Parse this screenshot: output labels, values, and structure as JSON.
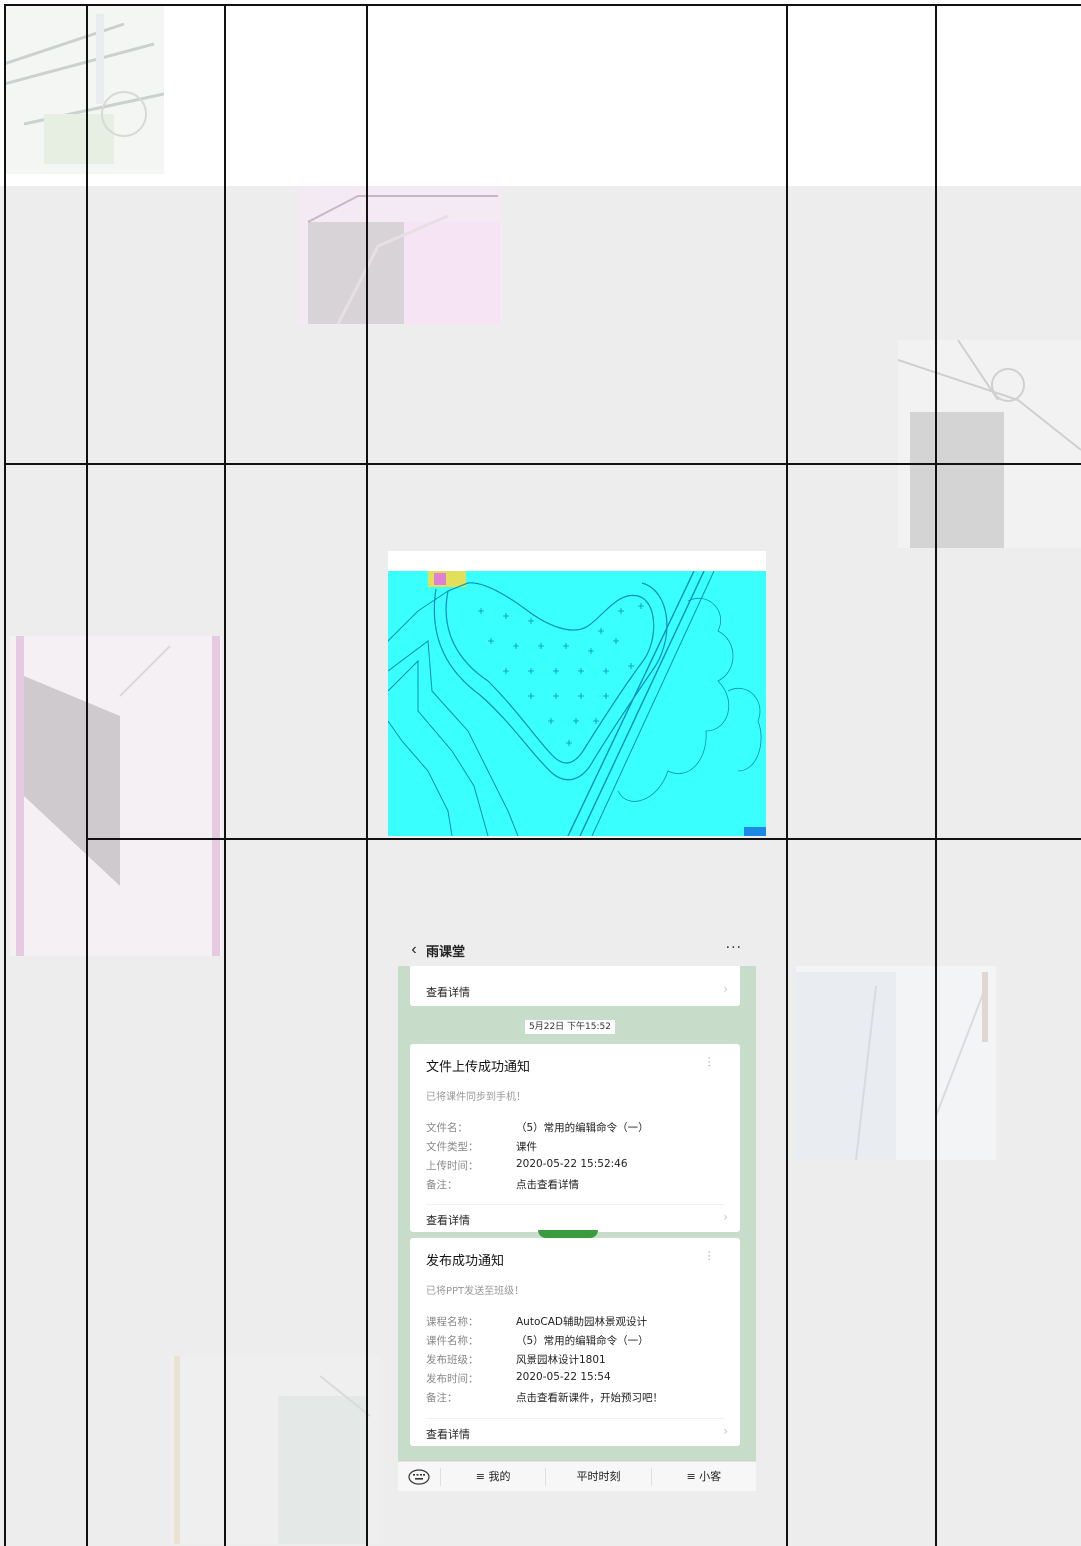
{
  "cad_image": {
    "colors": {
      "canvas": "#39ffff",
      "lines": "#0a8fb8",
      "corner": "#1e88e5"
    }
  },
  "chat": {
    "header": {
      "title": "雨课堂",
      "back_icon": "chevron-left-icon",
      "more_icon": "more-horizontal-icon",
      "more_text": "···"
    },
    "prev_card": {
      "view_detail": "查看详情"
    },
    "date_pill": "5月22日 下午15:52",
    "upload_card": {
      "title": "文件上传成功通知",
      "subtitle": "已将课件同步到手机！",
      "fields": [
        {
          "key": "文件名：",
          "value": "（5）常用的编辑命令（一）"
        },
        {
          "key": "文件类型：",
          "value": "课件"
        },
        {
          "key": "上传时间：",
          "value": "2020-05-22 15:52:46"
        },
        {
          "key": "备注：",
          "value": "点击查看详情"
        }
      ],
      "view_detail": "查看详情"
    },
    "publish_card": {
      "title": "发布成功通知",
      "subtitle": "已将PPT发送至班级！",
      "fields": [
        {
          "key": "课程名称：",
          "value": "AutoCAD辅助园林景观设计"
        },
        {
          "key": "课件名称：",
          "value": "（5）常用的编辑命令（一）"
        },
        {
          "key": "发布班级：",
          "value": "风景园林设计1801"
        },
        {
          "key": "发布时间：",
          "value": "2020-05-22 15:54"
        },
        {
          "key": "备注：",
          "value": "点击查看新课件，开始预习吧！"
        }
      ],
      "view_detail": "查看详情"
    },
    "bottom_bar": {
      "keyboard_icon": "keyboard-icon",
      "items": [
        "≡ 我的",
        "平时时刻",
        "≡ 小客"
      ]
    },
    "colors": {
      "chat_bg": "#c8ddc9",
      "header_bg": "#ededed",
      "card_bg": "#ffffff"
    }
  },
  "page": {
    "colors": {
      "band": "#ededed",
      "grid": "#111111"
    }
  }
}
